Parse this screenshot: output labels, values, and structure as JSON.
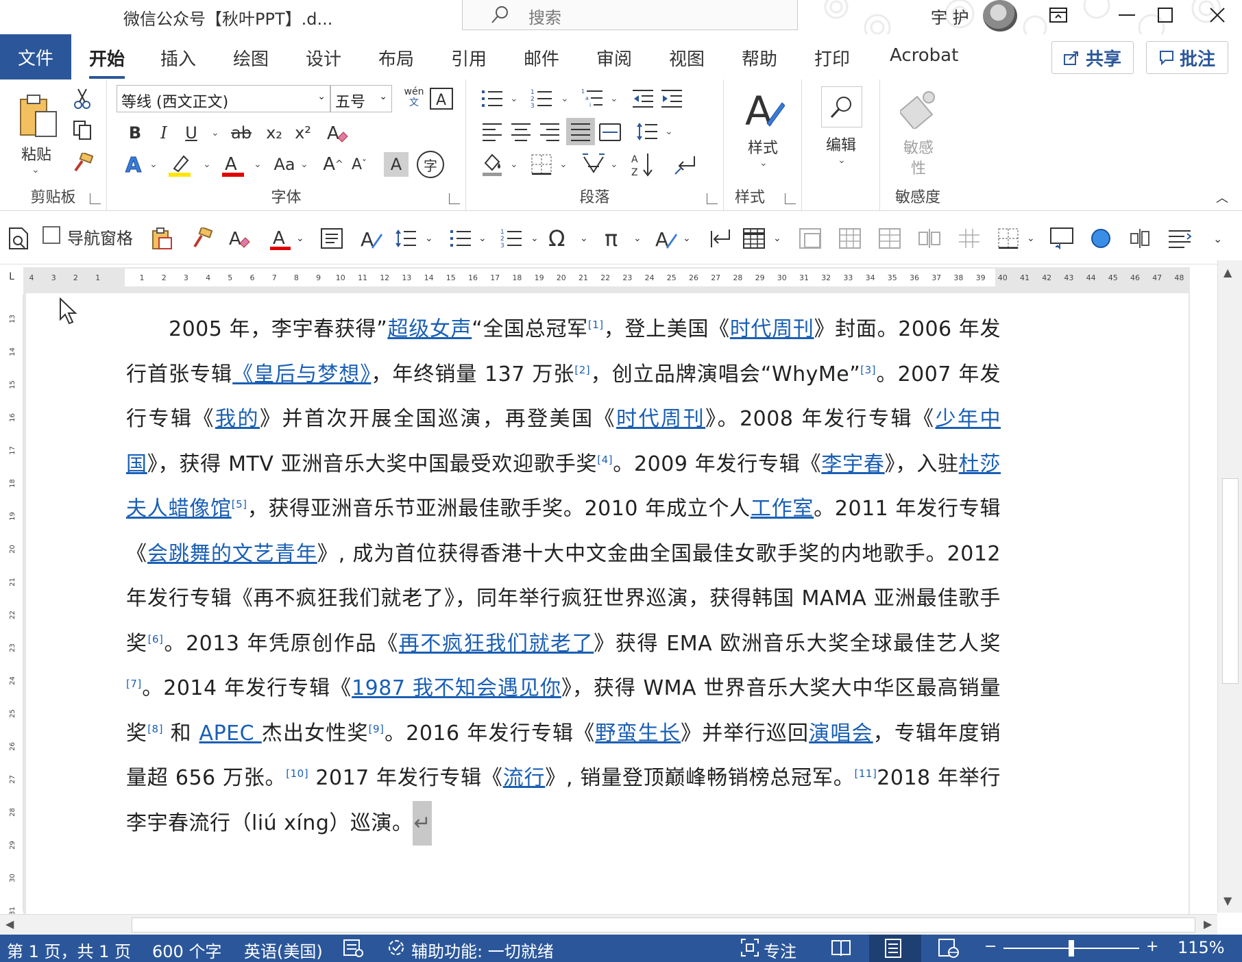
{
  "window": {
    "doc_title": "微信公众号【秋叶PPT】.d...",
    "search_placeholder": "搜索",
    "user_name": "宇 护"
  },
  "tabs": {
    "file": "文件",
    "items": [
      "开始",
      "插入",
      "绘图",
      "设计",
      "布局",
      "引用",
      "邮件",
      "审阅",
      "视图",
      "帮助",
      "打印",
      "Acrobat"
    ],
    "active": "开始",
    "share": "共享",
    "comment": "批注"
  },
  "ribbon": {
    "clipboard": {
      "paste": "粘贴",
      "label": "剪贴板"
    },
    "font": {
      "name": "等线 (西文正文)",
      "size": "五号",
      "wen_top": "wén",
      "wen_bottom": "文",
      "bold": "B",
      "italic": "I",
      "underline": "U",
      "strike": "ab",
      "subscript": "x₂",
      "superscript": "x²",
      "change_case": "Aa",
      "char_shade": "A",
      "enclose": "字",
      "label": "字体"
    },
    "paragraph": {
      "label": "段落"
    },
    "styles": {
      "styles_btn": "样式",
      "label": "样式"
    },
    "editing": {
      "edit_btn": "编辑"
    },
    "sensitivity": {
      "btn_line1": "敏感",
      "btn_line2": "性",
      "label": "敏感度"
    }
  },
  "quick_toolbar": {
    "nav_pane": "导航窗格"
  },
  "ruler": {
    "corner": "L",
    "marks": [
      "4",
      "3",
      "2",
      "1",
      "",
      "1",
      "2",
      "3",
      "4",
      "5",
      "6",
      "7",
      "8",
      "9",
      "10",
      "11",
      "12",
      "13",
      "14",
      "15",
      "16",
      "17",
      "18",
      "19",
      "20",
      "21",
      "22",
      "23",
      "24",
      "25",
      "26",
      "27",
      "28",
      "29",
      "30",
      "31",
      "32",
      "33",
      "34",
      "35",
      "36",
      "37",
      "38",
      "39",
      "40",
      "41",
      "42",
      "43",
      "44",
      "45",
      "46",
      "47",
      "48"
    ],
    "vmarks": [
      "13",
      "14",
      "15",
      "16",
      "17",
      "18",
      "19",
      "20",
      "21",
      "22",
      "23",
      "24",
      "25",
      "26",
      "27",
      "28",
      "29",
      "30",
      "31"
    ]
  },
  "document": {
    "t1": "2005 年，李宇春获得”",
    "l1": "超级女声",
    "t2": "“全国总冠军",
    "s1": "[1]",
    "t3": "，登上美国《",
    "l2": "时代周刊",
    "t4": "》封面。2006 年发行首张专辑",
    "l3": "《皇后与梦想》",
    "t5": "，年终销量 137 万张",
    "s2": "[2]",
    "t6": "，创立品牌演唱会“WhyMe”",
    "s3": "[3]",
    "t7": "。2007 年发行专辑《",
    "l4": "我的",
    "t8": "》并首次开展全国巡演，再登美国《",
    "l5": "时代周刊",
    "t9": "》。2008 年发行专辑《",
    "l6": "少年中国",
    "t10": "》，获得 MTV 亚洲音乐大奖中国最受欢迎歌手奖",
    "s4": "[4]",
    "t11": "。2009 年发行专辑《",
    "l7": "李宇春",
    "t12": "》，入驻",
    "l8": "杜莎夫人蜡像馆",
    "s5": "[5]",
    "t13": "，获得亚洲音乐节亚洲最佳歌手奖。2010 年成立个人",
    "l9": "工作室",
    "t14": "。2011 年发行专辑《",
    "l10": "会跳舞的文艺青年",
    "t15": "》, 成为首位获得香港十大中文金曲全国最佳女歌手奖的内地歌手。2012 年发行专辑《再不疯狂我们就老了》，同年举行疯狂世界巡演，获得韩国 MAMA 亚洲最佳歌手奖",
    "s6": "[6]",
    "t16": "。2013 年凭原创作品《",
    "l11": "再不疯狂我们就老了",
    "t17": "》获得 EMA 欧洲音乐大奖全球最佳艺人奖",
    "s7": "[7]",
    "t18": "。2014 年发行专辑《",
    "l12": "1987 我不知会遇见你",
    "t19": "》，获得 WMA 世界音乐大奖大中华区最高销量奖",
    "s8": "[8]",
    "t20": " 和 ",
    "l13": "APEC ",
    "t21": "杰出女性奖",
    "s9": "[9]",
    "t22": "。2016 年发行专辑《",
    "l14": "野蛮生长",
    "t23": "》并举行巡回",
    "l15": "演唱会",
    "t24": "，专辑年度销量超 656 万张。",
    "s10": "[10]",
    "t25": " 2017 年发行专辑《",
    "l16": "流行",
    "t26": "》, 销量登顶巅峰畅销榜总冠军。",
    "s11": "[11]",
    "t27": "2018 年举行李宇春流行（liú xíng）巡演。",
    "para_mark": "↵"
  },
  "status": {
    "page": "第 1 页，共 1 页",
    "words": "600 个字",
    "language": "英语(美国)",
    "accessibility": "辅助功能: 一切就绪",
    "focus": "专注",
    "zoom": "115%",
    "zoom_fraction": 0.5
  },
  "colors": {
    "brand": "#2b579a",
    "link": "#1a5fb4"
  }
}
